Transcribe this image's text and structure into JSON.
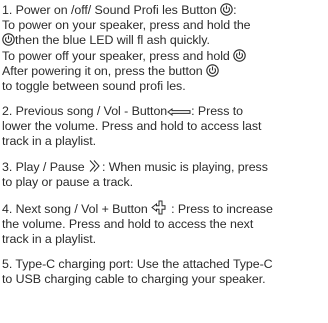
{
  "items": [
    {
      "lines": [
        {
          "before": "1. Power on /off/ Sound Profi les Button",
          "after": ":"
        },
        {
          "before": "To power on your speaker, press and hold the",
          "after": ""
        },
        {
          "before": "",
          "after": "then the blue LED will fl ash quickly."
        },
        {
          "before": "To power off your speaker, press and hold",
          "after": ""
        },
        {
          "before": "After powering it on, press the button",
          "after": ""
        },
        {
          "before": "to toggle between sound profi les.",
          "after": ""
        }
      ]
    },
    {
      "lines": [
        {
          "before": "2. Previous song / Vol - Button",
          "after": ": Press to"
        },
        {
          "before": "lower the volume. Press and hold to access last",
          "after": ""
        },
        {
          "before": "track in a playlist.",
          "after": ""
        }
      ]
    },
    {
      "lines": [
        {
          "before": "3. Play / Pause",
          "after": ": When music is playing, press"
        },
        {
          "before": "to play or pause a track.",
          "after": ""
        }
      ]
    },
    {
      "lines": [
        {
          "before": "4. Next song / Vol + Button",
          "after": ": Press to increase"
        },
        {
          "before": "the volume. Press and hold to access the next",
          "after": ""
        },
        {
          "before": "track in a playlist.",
          "after": ""
        }
      ]
    },
    {
      "lines": [
        {
          "before": "5. Type-C charging port: Use the attached Type-C",
          "after": ""
        },
        {
          "before": "to USB charging cable to charging your speaker.",
          "after": ""
        }
      ]
    }
  ],
  "icons": {
    "power": "power-button-icon",
    "previous": "previous-minus-button-icon",
    "play": "play-pause-icon",
    "next": "next-plus-button-icon"
  }
}
